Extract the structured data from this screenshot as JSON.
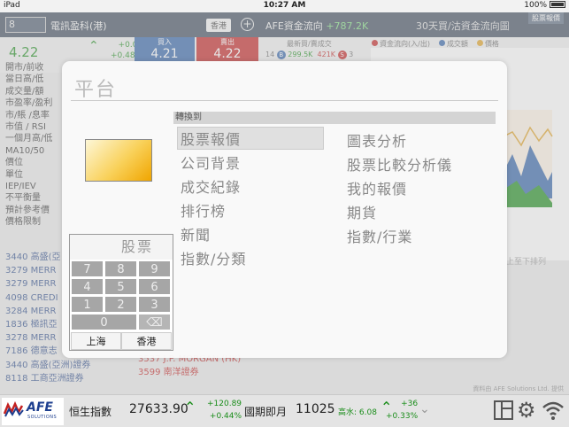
{
  "status": {
    "carrier": "iPad",
    "time": "10:27 AM",
    "battery": "100%"
  },
  "header": {
    "stock_code": "8",
    "stock_name": "電訊盈科(港)",
    "market_button": "香港",
    "afe_flow_label": "AFE資金流向",
    "afe_flow_value": "+787.2K",
    "flow_chart_title": "30天買/沽資金流向圖",
    "tag_button": "股票報價"
  },
  "quote": {
    "price": "4.22",
    "change": "+0.02",
    "change_pct": "+0.48%",
    "bid_label": "買入",
    "bid": "4.21",
    "ask_label": "賣出",
    "ask": "4.22",
    "vol_header": "最新買/賣成交",
    "vol_row": {
      "count": "14",
      "b_label": "B",
      "buy_vol": "299.5K",
      "sell_vol": "421K",
      "s_label": "S",
      "s_count": "3"
    },
    "legend": [
      {
        "label": "資金流向(入/出)",
        "color": "#c32020"
      },
      {
        "label": "成交額",
        "color": "#2f61a8"
      },
      {
        "label": "價格",
        "color": "#e0a020"
      }
    ],
    "fields": [
      "開市/前收",
      "當日高/低",
      "成交量/額",
      "市盈率/盈利",
      "市/賬 /息率",
      "市值 / RSI",
      "一個月高/低",
      "MA10/50",
      "價位",
      "單位",
      "IEP/IEV",
      "不平衡量",
      "預計參考價",
      "價格限制"
    ]
  },
  "brokers_left": [
    "3440 高盛(亞",
    "3279 MERR",
    "3279 MERR",
    "4098 CREDI",
    "3284 MERR",
    "1836 極訊亞",
    "3278 MERR",
    "7186 德意志",
    "3440 高盛(亞洲)證券",
    "8118 工商亞洲證券"
  ],
  "brokers_right": [
    "3537 J.P. MORGAN (HK)",
    "3599 南洋證券"
  ],
  "bg_hint": "上至下排列",
  "credit": "資料由 AFE Solutions Ltd. 提供",
  "modal": {
    "title": "平台",
    "goto_label": "轉換到",
    "left_items": [
      "股票報價",
      "公司背景",
      "成交紀錄",
      "排行榜",
      "新聞",
      "指數/分類"
    ],
    "right_items": [
      "圖表分析",
      "股票比較分析儀",
      "我的報價",
      "期貨",
      "指數/行業"
    ]
  },
  "keypad": {
    "title": "股票",
    "keys": [
      "7",
      "8",
      "9",
      "4",
      "5",
      "6",
      "1",
      "2",
      "3",
      "0"
    ],
    "markets": [
      "上海",
      "香港"
    ]
  },
  "bottom": {
    "logo_text": "AFE",
    "logo_sub": "SOLUTIONS",
    "index_name": "恒生指數",
    "index_value": "27633.90",
    "index_change": "+120.89",
    "index_change_pct": "+0.44%",
    "futures_name": "國期即月",
    "futures_value": "11025",
    "futures_high": "高水: 6.08",
    "futures_change": "+36",
    "futures_change_pct": "+0.33%"
  }
}
